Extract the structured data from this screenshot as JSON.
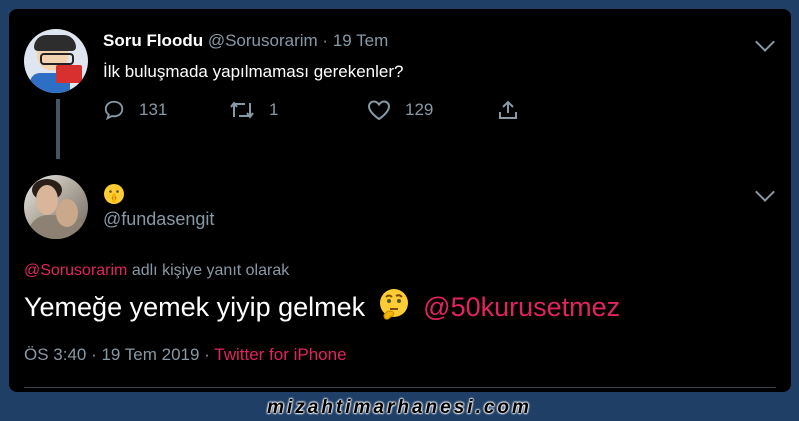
{
  "parent_tweet": {
    "display_name": "Soru Floodu",
    "handle": "@Sorusorarim",
    "separator": "·",
    "date": "19 Tem",
    "text": "İlk buluşmada yapılmaması gerekenler?",
    "replies": "131",
    "retweets": "1",
    "likes": "129"
  },
  "reply_tweet": {
    "display_name_emoji": "🤫",
    "handle": "@fundasengit",
    "reply_to_handle": "@Sorusorarim",
    "reply_to_suffix": " adlı kişiye yanıt olarak",
    "text_main": "Yemeğe yemek yiyip gelmek",
    "text_emoji": "🤔",
    "text_mention": "@50kurusetmez",
    "timestamp": "ÖS 3:40 · 19 Tem 2019 · ",
    "source": "Twitter for iPhone"
  },
  "watermark": "mizahtimarhanesi.com",
  "colors": {
    "background": "#000000",
    "mention": "#e0245e",
    "muted": "#8899a6",
    "frame": "#1f3f66"
  }
}
